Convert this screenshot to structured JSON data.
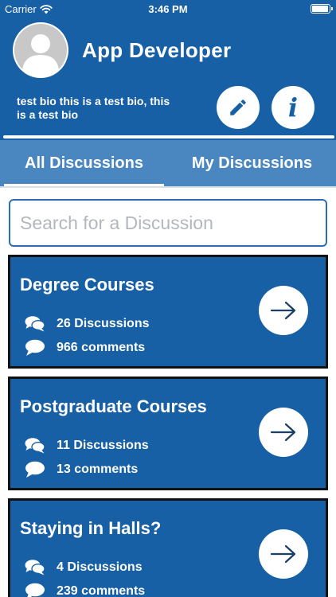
{
  "status_bar": {
    "carrier": "Carrier",
    "time": "3:46 PM",
    "battery_level": 0.95
  },
  "profile": {
    "name": "App Developer",
    "bio": "test bio this is a test bio, this is a test bio",
    "edit_icon": "pencil-icon",
    "info_icon": "info-icon",
    "info_glyph": "i"
  },
  "tabs": [
    {
      "label": "All Discussions",
      "selected": true
    },
    {
      "label": "My Discussions",
      "selected": false
    }
  ],
  "search": {
    "placeholder": "Search for a Discussion",
    "value": ""
  },
  "categories": [
    {
      "title": "Degree Courses",
      "discussions": "26 Discussions",
      "comments": "966 comments"
    },
    {
      "title": "Postgraduate Courses",
      "discussions": "11 Discussions",
      "comments": "13 comments"
    },
    {
      "title": "Staying in Halls?",
      "discussions": "4 Discussions",
      "comments": "239 comments"
    }
  ],
  "colors": {
    "primary": "#1760a6",
    "tab_bar": "#4a86c0",
    "card_border": "#111111",
    "placeholder": "#b3b7bd"
  }
}
